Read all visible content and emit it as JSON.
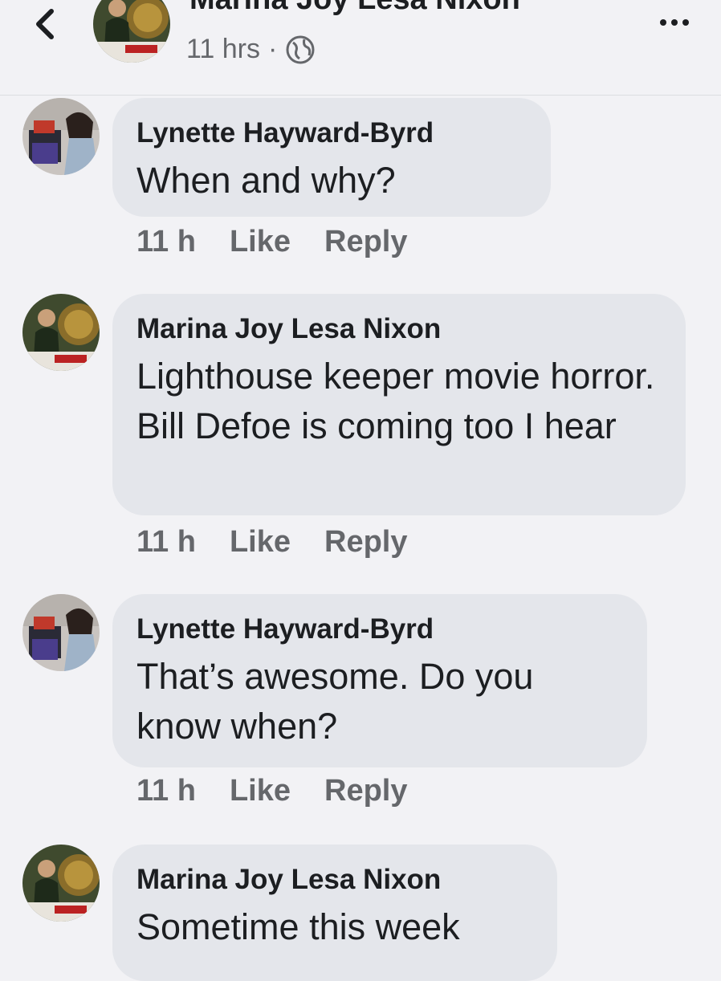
{
  "header": {
    "name": "Marina Joy Lesa Nixon",
    "time": "11 hrs",
    "separator": "·",
    "back_icon": "chevron-left-icon",
    "privacy_icon": "globe-icon",
    "more_icon": "more-horizontal-icon"
  },
  "comments": [
    {
      "author": "Lynette Hayward-Byrd",
      "text": "When and why?",
      "time": "11 h",
      "like": "Like",
      "reply": "Reply"
    },
    {
      "author": "Marina Joy Lesa Nixon",
      "text": "Lighthouse keeper movie horror. Bill Defoe is coming too I hear",
      "time": "11 h",
      "like": "Like",
      "reply": "Reply"
    },
    {
      "author": "Lynette Hayward-Byrd",
      "text": "That’s awesome.  Do you know when?",
      "time": "11 h",
      "like": "Like",
      "reply": "Reply"
    },
    {
      "author": "Marina Joy Lesa Nixon",
      "text": "Sometime this week"
    }
  ],
  "colors": {
    "background": "#f2f2f5",
    "bubble": "#e4e6eb",
    "secondary_text": "#65676b",
    "primary_text": "#1c1e21"
  }
}
